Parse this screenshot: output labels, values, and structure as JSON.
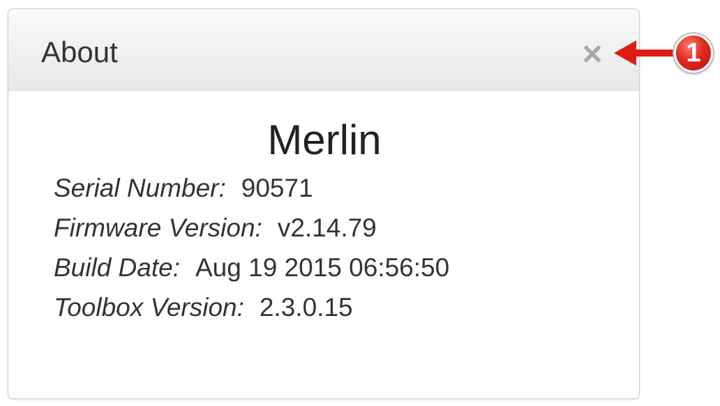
{
  "dialog": {
    "title": "About",
    "close_label": "×",
    "device_name": "Merlin",
    "info": [
      {
        "label": "Serial Number:",
        "value": "90571"
      },
      {
        "label": "Firmware Version:",
        "value": "v2.14.79"
      },
      {
        "label": "Build Date:",
        "value": "Aug 19 2015 06:56:50"
      },
      {
        "label": "Toolbox Version:",
        "value": "2.3.0.15"
      }
    ]
  },
  "annotation": {
    "callout_number": "1",
    "callout_color": "#e02a1f",
    "arrow_direction": "left",
    "target": "close-button"
  },
  "icons": {
    "close": "close-icon",
    "arrow": "arrow-left-icon"
  }
}
